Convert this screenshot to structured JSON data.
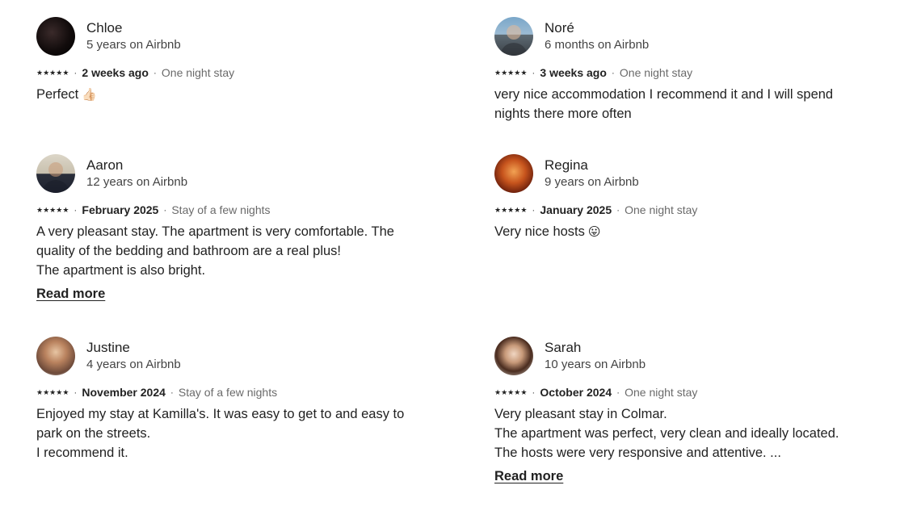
{
  "reviews": [
    {
      "name": "Chloe",
      "tenure": "5 years on Airbnb",
      "rating": 5,
      "date": "2 weeks ago",
      "stay": "One night stay",
      "text_lines": [
        "Perfect"
      ],
      "emoji": "👍🏻"
    },
    {
      "name": "Noré",
      "tenure": "6 months on Airbnb",
      "rating": 5,
      "date": "3 weeks ago",
      "stay": "One night stay",
      "text_lines": [
        "very nice accommodation I recommend it and I will spend",
        "nights there more often"
      ]
    },
    {
      "name": "Aaron",
      "tenure": "12 years on Airbnb",
      "rating": 5,
      "date": "February 2025",
      "stay": "Stay of a few nights",
      "text_lines": [
        "A very pleasant stay. The apartment is very comfortable. The",
        "quality of the bedding and bathroom are a real plus!",
        "The apartment is also bright."
      ],
      "read_more": "Read more"
    },
    {
      "name": "Regina",
      "tenure": "9 years on Airbnb",
      "rating": 5,
      "date": "January 2025",
      "stay": "One night stay",
      "text_lines": [
        "Very nice hosts"
      ],
      "emoji": "😛"
    },
    {
      "name": "Justine",
      "tenure": "4 years on Airbnb",
      "rating": 5,
      "date": "November 2024",
      "stay": "Stay of a few nights",
      "text_lines": [
        "Enjoyed my stay at Kamilla's. It was easy to get to and easy to",
        "park on the streets.",
        "I recommend it."
      ]
    },
    {
      "name": "Sarah",
      "tenure": "10 years on Airbnb",
      "rating": 5,
      "date": "October 2024",
      "stay": "One night stay",
      "text_lines": [
        "Very pleasant stay in Colmar.",
        "The apartment was perfect, very clean and ideally located.",
        "The hosts were very responsive and attentive. ..."
      ],
      "read_more": "Read more"
    }
  ],
  "icons": {
    "star": "star-icon",
    "separator": "·"
  }
}
